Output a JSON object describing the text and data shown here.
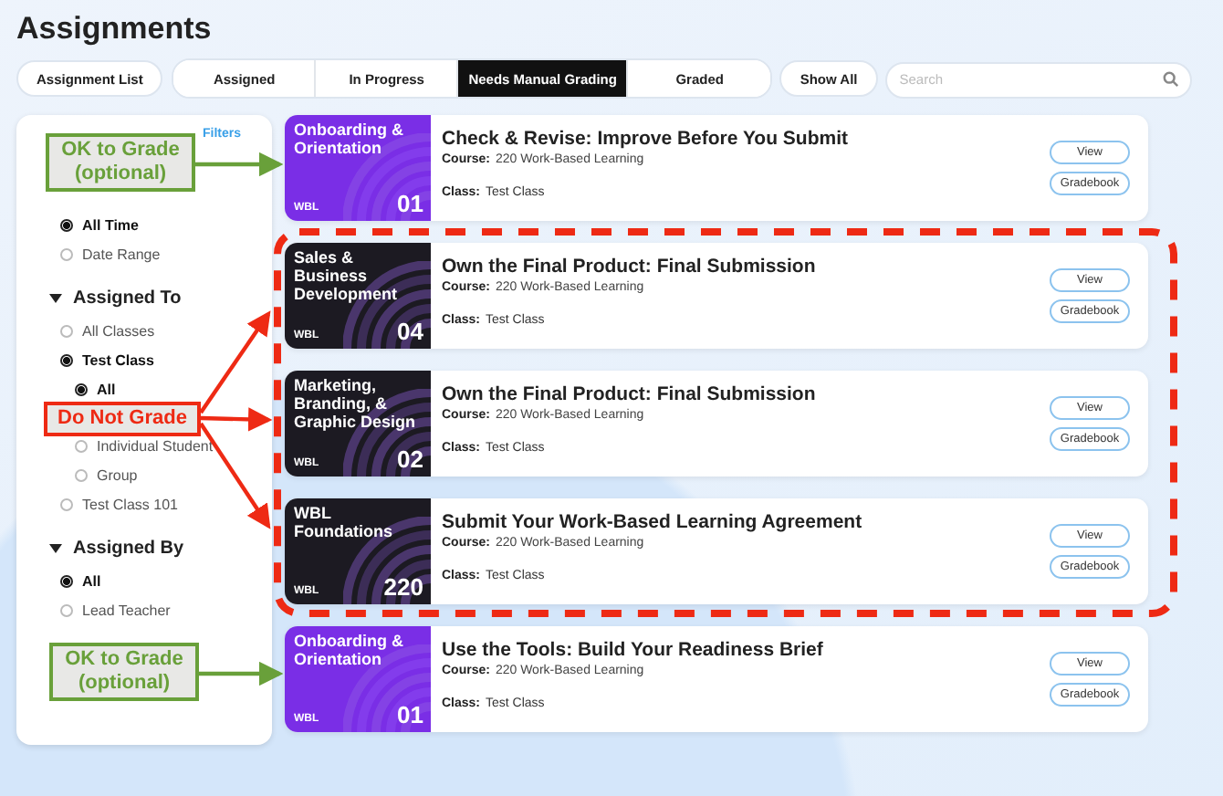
{
  "page": {
    "title": "Assignments"
  },
  "view_tab": {
    "label": "Assignment List"
  },
  "tabs": [
    {
      "label": "Assigned",
      "selected": false
    },
    {
      "label": "In Progress",
      "selected": false
    },
    {
      "label": "Needs Manual Grading",
      "selected": true
    },
    {
      "label": "Graded",
      "selected": false
    }
  ],
  "show_all": {
    "label": "Show All"
  },
  "search": {
    "placeholder": "Search"
  },
  "sidebar": {
    "filters_link": "Filters",
    "sections": [
      {
        "options": [
          {
            "label": "All Time",
            "selected": true
          },
          {
            "label": "Date Range",
            "selected": false
          }
        ]
      },
      {
        "title": "Assigned To",
        "expanded": true,
        "options": [
          {
            "label": "All Classes",
            "selected": false
          },
          {
            "label": "Test Class",
            "selected": true,
            "children": [
              {
                "label": "All",
                "selected": true
              },
              {
                "label": "Individual Student",
                "selected": false
              },
              {
                "label": "Group",
                "selected": false
              }
            ]
          },
          {
            "label": "Test Class 101",
            "selected": false
          }
        ]
      },
      {
        "title": "Assigned By",
        "expanded": true,
        "options": [
          {
            "label": "All",
            "selected": true
          },
          {
            "label": "Lead Teacher",
            "selected": false
          }
        ]
      }
    ]
  },
  "assignments": [
    {
      "thumb_title": "Onboarding & Orientation",
      "thumb_tag": "WBL",
      "thumb_number": "01",
      "color": "#7a2ee6",
      "title": "Check & Revise: Improve Before You Submit",
      "course_label": "Course:",
      "course": "220 Work-Based Learning",
      "class_label": "Class:",
      "class": "Test Class",
      "buttons": [
        "View",
        "Gradebook"
      ]
    },
    {
      "thumb_title": "Sales & Business Development",
      "thumb_tag": "WBL",
      "thumb_number": "04",
      "color": "#1c1a22",
      "title": "Own the Final Product: Final Submission",
      "course_label": "Course:",
      "course": "220 Work-Based Learning",
      "class_label": "Class:",
      "class": "Test Class",
      "buttons": [
        "View",
        "Gradebook"
      ]
    },
    {
      "thumb_title": "Marketing, Branding, & Graphic Design",
      "thumb_tag": "WBL",
      "thumb_number": "02",
      "color": "#1c1a22",
      "title": "Own the Final Product: Final Submission",
      "course_label": "Course:",
      "course": "220 Work-Based Learning",
      "class_label": "Class:",
      "class": "Test Class",
      "buttons": [
        "View",
        "Gradebook"
      ]
    },
    {
      "thumb_title": "WBL Foundations",
      "thumb_tag": "WBL",
      "thumb_number": "220",
      "color": "#1c1a22",
      "title": "Submit Your Work-Based Learning Agreement",
      "course_label": "Course:",
      "course": "220 Work-Based Learning",
      "class_label": "Class:",
      "class": "Test Class",
      "buttons": [
        "View",
        "Gradebook"
      ]
    },
    {
      "thumb_title": "Onboarding & Orientation",
      "thumb_tag": "WBL",
      "thumb_number": "01",
      "color": "#7a2ee6",
      "title": "Use the Tools: Build Your Readiness Brief",
      "course_label": "Course:",
      "course": "220 Work-Based Learning",
      "class_label": "Class:",
      "class": "Test Class",
      "buttons": [
        "View",
        "Gradebook"
      ]
    }
  ],
  "annotations": [
    {
      "kind": "ok",
      "text": "OK to Grade (optional)"
    },
    {
      "kind": "no",
      "text": "Do Not Grade"
    },
    {
      "kind": "ok",
      "text": "OK to Grade (optional)"
    }
  ]
}
